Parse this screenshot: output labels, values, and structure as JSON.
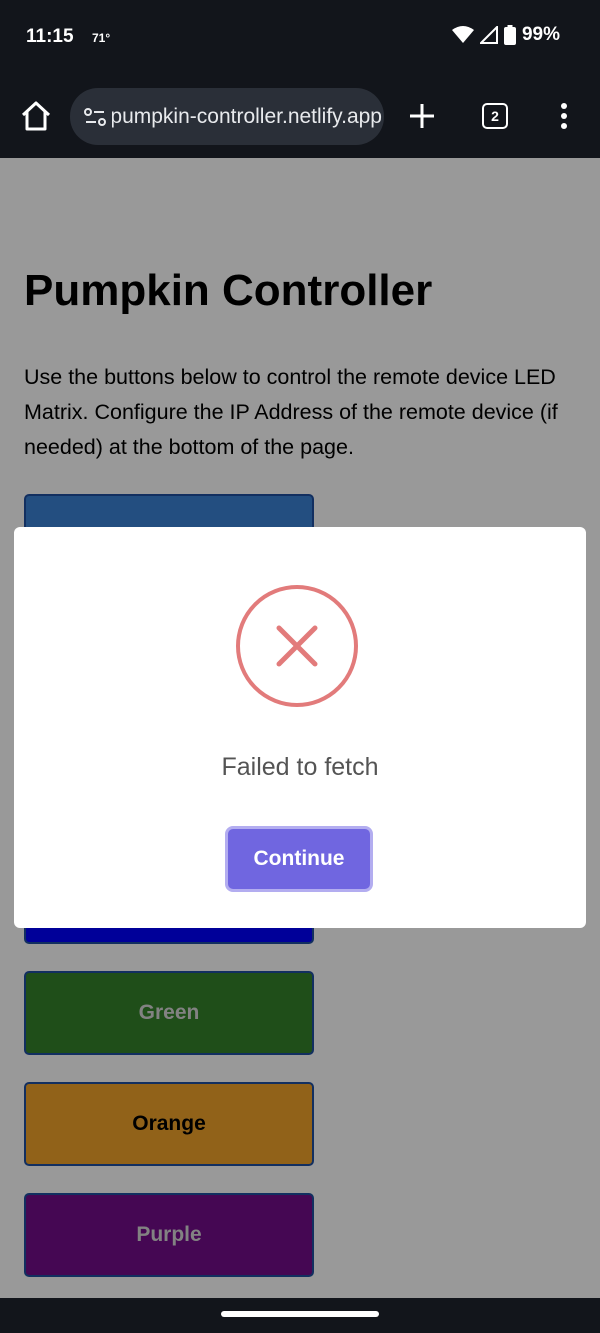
{
  "status_bar": {
    "time": "11:15",
    "temperature": "71°",
    "battery": "99%",
    "icons": [
      "wifi-icon",
      "signal-icon",
      "battery-icon"
    ]
  },
  "browser": {
    "url": "pumpkin-controller.netlify.app",
    "tab_count": "2",
    "icons": [
      "home-icon",
      "site-settings-icon",
      "new-tab-icon",
      "tabs-icon",
      "more-menu-icon"
    ]
  },
  "page": {
    "title": "Pumpkin Controller",
    "description": "Use the buttons below to control the remote device LED Matrix. Configure the IP Address of the remote device (if needed) at the bottom of the page.",
    "buttons": [
      {
        "label": "",
        "color": "#3b82d6",
        "text_color": "#ffffff"
      },
      {
        "label": "",
        "color": "#0000ff",
        "text_color": "#ffffff"
      },
      {
        "label": "Green",
        "color": "#35822a",
        "text_color": "#d9d9d9"
      },
      {
        "label": "Orange",
        "color": "#f2a42b",
        "text_color": "#000000"
      },
      {
        "label": "Purple",
        "color": "#740d8a",
        "text_color": "#d9d9d9"
      }
    ]
  },
  "modal": {
    "icon": "error-x-icon",
    "message": "Failed to fetch",
    "button_label": "Continue",
    "accent": "#7066e0",
    "error_color": "#e27b7b"
  }
}
